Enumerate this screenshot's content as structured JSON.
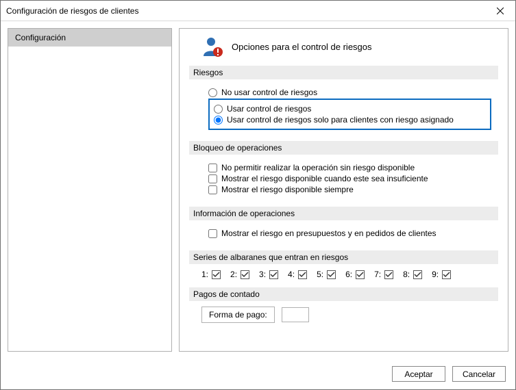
{
  "window": {
    "title": "Configuración de riesgos de clientes"
  },
  "nav": {
    "items": [
      "Configuración"
    ]
  },
  "header": {
    "title": "Opciones para el control de riesgos"
  },
  "sections": {
    "riesgos": {
      "label": "Riesgos",
      "options": [
        "No usar control de riesgos",
        "Usar control de riesgos",
        "Usar control de riesgos solo para clientes con riesgo asignado"
      ],
      "selected": 2
    },
    "bloqueo": {
      "label": "Bloqueo de operaciones",
      "options": [
        "No permitir realizar la operación sin riesgo disponible",
        "Mostrar el riesgo disponible cuando este sea insuficiente",
        "Mostrar el riesgo disponible siempre"
      ]
    },
    "info": {
      "label": "Información de operaciones",
      "options": [
        "Mostrar el riesgo en presupuestos y en pedidos de clientes"
      ]
    },
    "series": {
      "label": "Series de albaranes que entran en riesgos",
      "items": [
        "1:",
        "2:",
        "3:",
        "4:",
        "5:",
        "6:",
        "7:",
        "8:",
        "9:"
      ],
      "checked": [
        true,
        true,
        true,
        true,
        true,
        true,
        true,
        true,
        true
      ]
    },
    "pagos": {
      "label": "Pagos de contado",
      "field_label": "Forma de pago:",
      "field_value": ""
    }
  },
  "footer": {
    "ok": "Aceptar",
    "cancel": "Cancelar"
  }
}
